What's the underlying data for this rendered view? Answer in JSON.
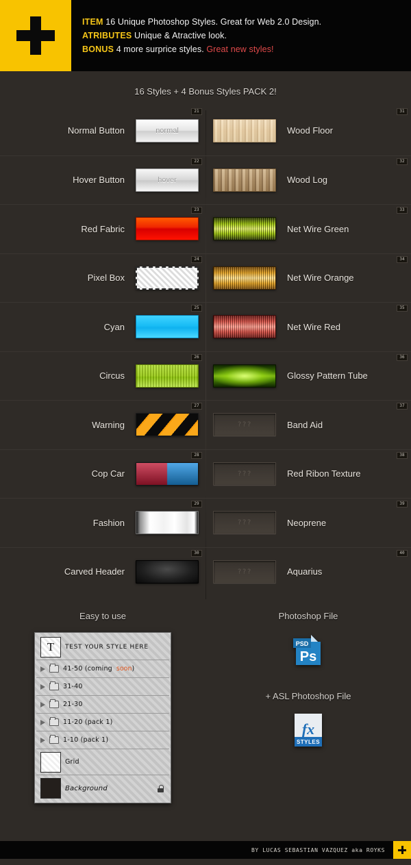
{
  "header": {
    "logo_icon": "plus-icon",
    "logo_color": "#f8c300",
    "lines": [
      {
        "keyword": "ITEM",
        "text": "16 Unique Photoshop Styles. Great for Web 2.0 Design."
      },
      {
        "keyword": "ATRIBUTES",
        "text": "Unique & Atractive look."
      },
      {
        "keyword": "BONUS",
        "text": "4 more surprice styles.",
        "highlight": "Great new styles!"
      }
    ]
  },
  "subtitle": "16 Styles + 4 Bonus Styles PACK 2!",
  "styles_left": [
    {
      "num": "21",
      "label": "Normal Button",
      "swatch_class": "sw-normal",
      "swatch_text": "normal"
    },
    {
      "num": "22",
      "label": "Hover Button",
      "swatch_class": "sw-hover",
      "swatch_text": "hover"
    },
    {
      "num": "23",
      "label": "Red Fabric",
      "swatch_class": "sw-redfabric",
      "swatch_text": ""
    },
    {
      "num": "24",
      "label": "Pixel Box",
      "swatch_class": "sw-pixelbox",
      "swatch_text": ""
    },
    {
      "num": "25",
      "label": "Cyan",
      "swatch_class": "sw-cyan",
      "swatch_text": ""
    },
    {
      "num": "26",
      "label": "Circus",
      "swatch_class": "sw-circus",
      "swatch_text": ""
    },
    {
      "num": "27",
      "label": "Warning",
      "swatch_class": "sw-warning",
      "swatch_text": ""
    },
    {
      "num": "28",
      "label": "Cop Car",
      "swatch_class": "sw-copcar",
      "swatch_text": ""
    },
    {
      "num": "29",
      "label": "Fashion",
      "swatch_class": "sw-fashion",
      "swatch_text": ""
    },
    {
      "num": "30",
      "label": "Carved Header",
      "swatch_class": "sw-carved",
      "swatch_text": ""
    }
  ],
  "styles_right": [
    {
      "num": "31",
      "label": "Wood Floor",
      "swatch_class": "sw-woodfloor",
      "swatch_text": ""
    },
    {
      "num": "32",
      "label": "Wood Log",
      "swatch_class": "sw-woodlog",
      "swatch_text": ""
    },
    {
      "num": "33",
      "label": "Net Wire Green",
      "swatch_class": "sw-netgreen",
      "swatch_text": ""
    },
    {
      "num": "34",
      "label": "Net Wire Orange",
      "swatch_class": "sw-netorange",
      "swatch_text": ""
    },
    {
      "num": "35",
      "label": "Net Wire Red",
      "swatch_class": "sw-netred",
      "swatch_text": ""
    },
    {
      "num": "36",
      "label": "Glossy Pattern Tube",
      "swatch_class": "sw-glossytube",
      "swatch_text": ""
    },
    {
      "num": "37",
      "label": "Band Aid",
      "swatch_class": "sw-empty",
      "swatch_text": "???"
    },
    {
      "num": "38",
      "label": "Red Ribon Texture",
      "swatch_class": "sw-empty",
      "swatch_text": "???"
    },
    {
      "num": "39",
      "label": "Neoprene",
      "swatch_class": "sw-empty",
      "swatch_text": "???"
    },
    {
      "num": "40",
      "label": "Aquarius",
      "swatch_class": "sw-empty",
      "swatch_text": "???"
    }
  ],
  "easy_to_use": {
    "title": "Easy to use",
    "layers": [
      {
        "type": "text",
        "name": "TEST YOUR STYLE HERE",
        "thumb": "T"
      },
      {
        "type": "folder",
        "name": "41-50  (coming ",
        "suffix": "soon",
        "suffix2": ")"
      },
      {
        "type": "folder",
        "name": "31-40"
      },
      {
        "type": "folder",
        "name": "21-30"
      },
      {
        "type": "folder",
        "name": "11-20  (pack 1)"
      },
      {
        "type": "folder",
        "name": "1-10   (pack 1)"
      },
      {
        "type": "grid",
        "name": "Grid"
      },
      {
        "type": "background",
        "name": "Background",
        "locked": true
      }
    ]
  },
  "files": {
    "psd_title": "Photoshop File",
    "psd_badge": "PSD",
    "psd_glyph": "Ps",
    "asl_title": "+ ASL Photoshop File",
    "asl_glyph": "fx",
    "asl_badge": "STYLES",
    "psd_color": "#2383c4",
    "asl_color": "#1f6fb8"
  },
  "footer": {
    "credit": "BY LUCAS SEBASTIAN VAZQUEZ aka ROYKS",
    "plus_icon": "plus-icon"
  }
}
